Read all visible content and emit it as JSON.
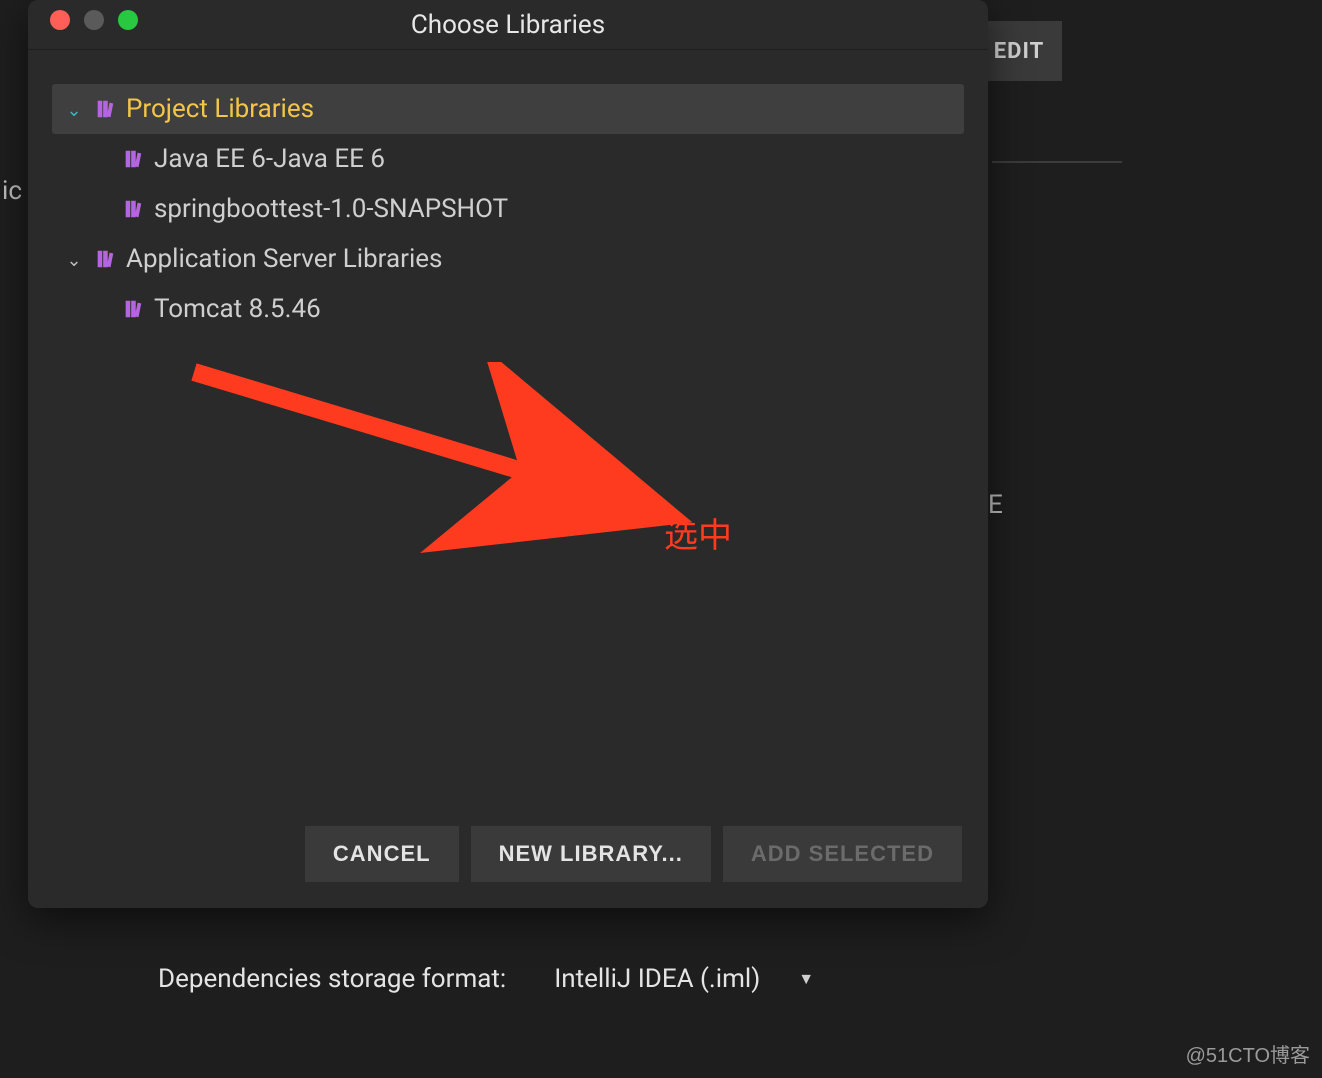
{
  "background": {
    "edit_button_label": "EDIT",
    "left_clipped_text": "ic",
    "right_clipped_text": "E",
    "deps_label": "Dependencies storage format:",
    "deps_value": "IntelliJ IDEA (.iml)",
    "watermark": "@51CTO博客"
  },
  "dialog": {
    "title": "Choose Libraries",
    "annotation_text": "选中",
    "buttons": {
      "cancel": "CANCEL",
      "new_library": "NEW LIBRARY...",
      "add_selected": "ADD SELECTED"
    },
    "tree": [
      {
        "label": "Project Libraries",
        "expanded": true,
        "selected": true,
        "children": [
          {
            "label": "Java EE 6-Java EE 6"
          },
          {
            "label": "springboottest-1.0-SNAPSHOT"
          }
        ]
      },
      {
        "label": "Application Server Libraries",
        "expanded": true,
        "selected": false,
        "children": [
          {
            "label": "Tomcat 8.5.46"
          }
        ]
      }
    ]
  }
}
